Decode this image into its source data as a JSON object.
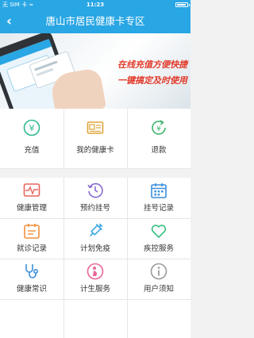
{
  "status_bar": {
    "carrier": "无 SIM 卡 ≈",
    "time": "11:23"
  },
  "nav": {
    "back": "‹",
    "title": "唐山市居民健康卡专区"
  },
  "banner": {
    "slogan_line1": "在线充值方便快捷",
    "slogan_line2": "一键搞定及时使用"
  },
  "top_actions": [
    {
      "label": "充值",
      "icon": "yuan-coin-icon",
      "color": "#2fb893"
    },
    {
      "label": "我的健康卡",
      "icon": "health-card-icon",
      "color": "#e0a53a"
    },
    {
      "label": "退款",
      "icon": "refund-icon",
      "color": "#3fb36b"
    }
  ],
  "services": [
    {
      "label": "健康管理",
      "icon": "heart-monitor-icon",
      "color": "#e8655b"
    },
    {
      "label": "预约挂号",
      "icon": "clock-history-icon",
      "color": "#8a6bd1"
    },
    {
      "label": "挂号记录",
      "icon": "calendar-icon",
      "color": "#3b8fdb"
    },
    {
      "label": "就诊记录",
      "icon": "visit-record-icon",
      "color": "#f0913b"
    },
    {
      "label": "计划免疫",
      "icon": "syringe-icon",
      "color": "#3aa6e0"
    },
    {
      "label": "疾控服务",
      "icon": "heart-outline-icon",
      "color": "#3cbf83"
    },
    {
      "label": "健康常识",
      "icon": "stethoscope-icon",
      "color": "#3b8fdb"
    },
    {
      "label": "计生服务",
      "icon": "maternity-icon",
      "color": "#e8659a"
    },
    {
      "label": "用户须知",
      "icon": "info-icon",
      "color": "#999999"
    }
  ]
}
